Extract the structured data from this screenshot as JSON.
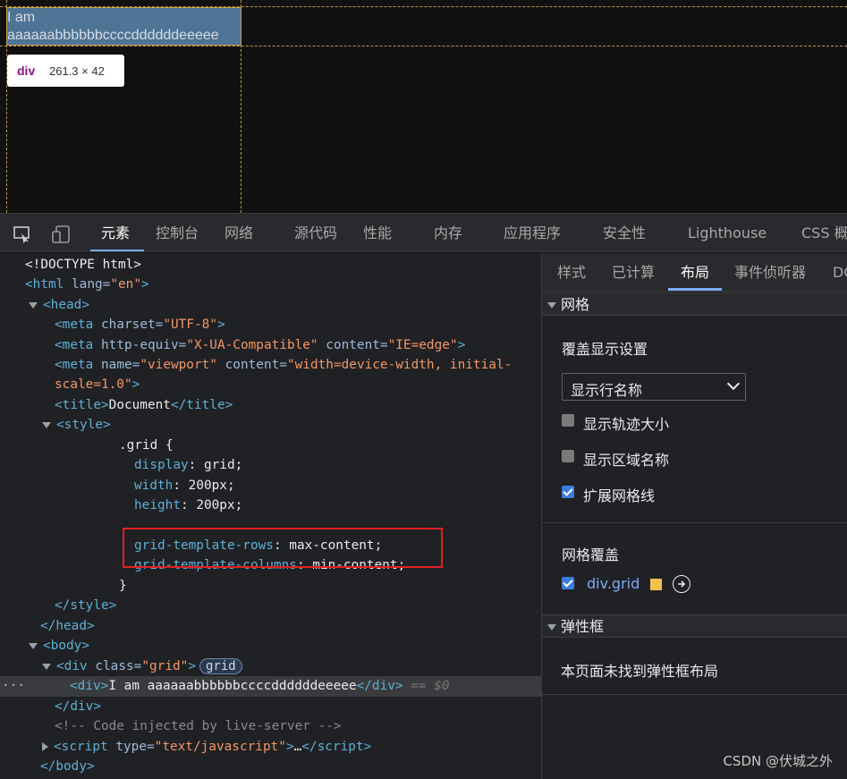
{
  "preview": {
    "highlight_text": "I am\naaaaaabbbbbbccccddddddeeeee",
    "tooltip_tag": "div",
    "tooltip_dims": "261.3 × 42"
  },
  "devtools_tabs": [
    "元素",
    "控制台",
    "网络",
    "源代码",
    "性能",
    "内存",
    "应用程序",
    "安全性",
    "Lighthouse",
    "CSS 概"
  ],
  "elements": {
    "doctype": "<!DOCTYPE html>",
    "html_open": {
      "tag": "html",
      "attr": "lang",
      "val": "\"en\""
    },
    "head_open": "<head>",
    "meta1": {
      "attr": "charset",
      "val": "\"UTF-8\""
    },
    "meta2": {
      "attr1": "http-equiv",
      "val1": "\"X-UA-Compatible\"",
      "attr2": "content",
      "val2": "\"IE=edge\""
    },
    "meta3": {
      "attr1": "name",
      "val1": "\"viewport\"",
      "attr2": "content",
      "val2a": "\"width=device-width, initial-",
      "val2b": "scale=1.0\""
    },
    "title": "Document",
    "style_open": "<style>",
    "css_selector": ".grid {",
    "css_display": {
      "prop": "display",
      "val": "grid;"
    },
    "css_width": {
      "prop": "width",
      "val": "200px;"
    },
    "css_height": {
      "prop": "height",
      "val": "200px;"
    },
    "css_rows": {
      "prop": "grid-template-rows",
      "val": "max-content;"
    },
    "css_cols": {
      "prop": "grid-template-columns",
      "val": "min-content;"
    },
    "css_close": "}",
    "style_close": "</style>",
    "head_close": "</head>",
    "body_open": "<body>",
    "div_grid": {
      "attr": "class",
      "val": "\"grid\"",
      "badge": "grid"
    },
    "div_inner_text": "I am aaaaaabbbbbbccccddddddeeeee",
    "div_inner_marker": "== $0",
    "div_close": "</div>",
    "comment": "<!-- Code injected by live-server -->",
    "script": {
      "attr": "type",
      "val": "\"text/javascript\"",
      "ellipsis": "…"
    },
    "body_close": "</body>",
    "dots": "···"
  },
  "side": {
    "tabs": [
      "样式",
      "已计算",
      "布局",
      "事件侦听器",
      "DO"
    ],
    "grid_section": "网格",
    "overlay_settings": "覆盖显示设置",
    "select_value": "显示行名称",
    "checks": [
      {
        "label": "显示轨迹大小",
        "checked": false
      },
      {
        "label": "显示区域名称",
        "checked": false
      },
      {
        "label": "扩展网格线",
        "checked": true
      }
    ],
    "grid_overlay": "网格覆盖",
    "overlay_item": "div.grid",
    "overlay_color": "#f2c14e",
    "flex_section": "弹性框",
    "flex_empty": "本页面未找到弹性框布局"
  },
  "watermark": "CSDN @伏城之外"
}
